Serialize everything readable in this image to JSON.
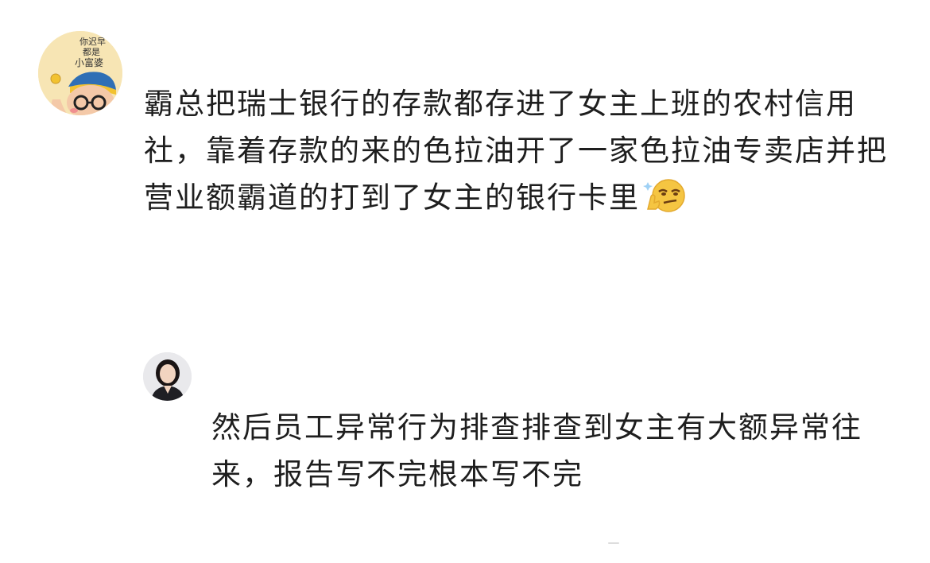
{
  "main_comment": {
    "text": "霸总把瑞士银行的存款都存进了女主上班的农村信用社，靠着存款的来的色拉油开了一家色拉油专卖店并把营业额霸道的打到了女主的银行卡里",
    "emoji": "smirk-emoji",
    "avatar": {
      "text_lines": [
        "你迟早",
        "都是",
        "小富婆"
      ]
    }
  },
  "reply": {
    "text": "然后员工异常行为排查排查到女主有大额异常往来，报告写不完根本写不完",
    "avatar": "photo-avatar"
  },
  "colors": {
    "background": "#ffffff",
    "text": "#1e1e1e",
    "avatar_bg_main": "#f7e5b4",
    "avatar_bg_reply": "#e9e9ec"
  }
}
